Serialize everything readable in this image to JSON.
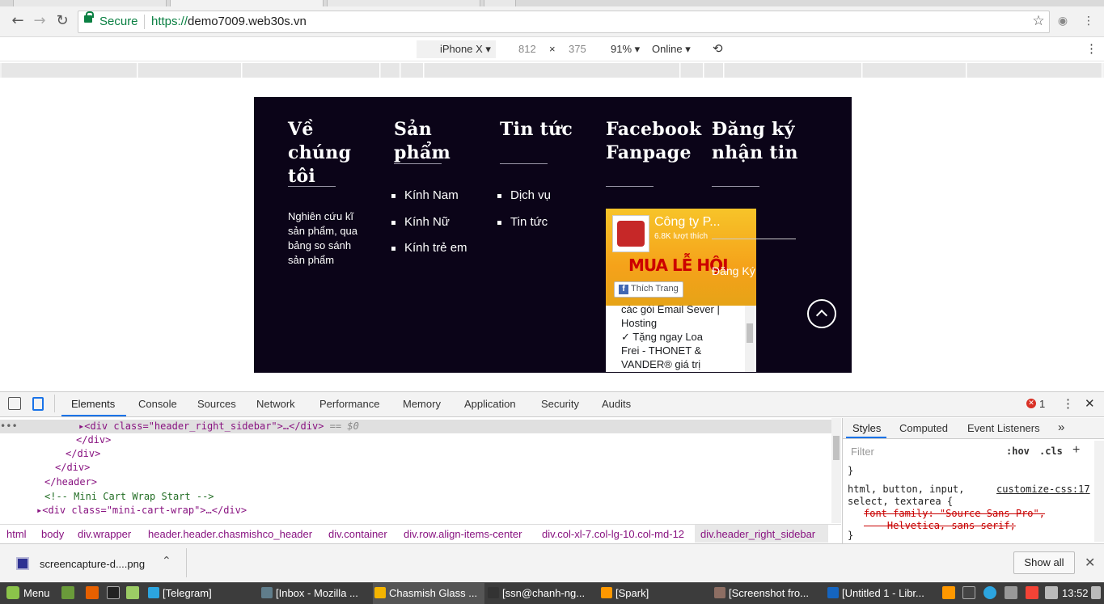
{
  "browser": {
    "secure_label": "Secure",
    "url_scheme": "https://",
    "url_host": "demo7009.web30s.vn"
  },
  "device_toolbar": {
    "device": "iPhone X",
    "width": "812",
    "times": "×",
    "height": "375",
    "zoom": "91%",
    "network": "Online"
  },
  "site": {
    "columns": [
      {
        "title": "Về chúng tôi",
        "text": "Nghiên cứu kĩ sản phẩm, qua bảng so sánh sản phẩm"
      },
      {
        "title": "Sản phẩm",
        "items": [
          "Kính Nam",
          "Kính Nữ",
          "Kính trẻ em"
        ]
      },
      {
        "title": "Tin tức",
        "items": [
          "Dịch vụ",
          "Tin tức"
        ]
      },
      {
        "title": "Facebook Fanpage"
      },
      {
        "title": "Đăng ký nhận tin",
        "subscribe": "Đăng Ký"
      }
    ],
    "facebook": {
      "page_name": "Công ty P...",
      "likes": "6.8K lượt thích",
      "banner_text": "MUA LỄ HỘI",
      "like_button": "Thích Trang",
      "post_text": "các gói Email Sever |\nHosting\n   ✓ Tặng ngay Loa\nFrei - THONET &\nVANDER® giá trị"
    }
  },
  "devtools": {
    "tabs": [
      "Elements",
      "Console",
      "Sources",
      "Network",
      "Performance",
      "Memory",
      "Application",
      "Security",
      "Audits"
    ],
    "error_count": "1",
    "elements_lines": [
      {
        "indent": 0,
        "text": "<div class=\"header_right_sidebar\">…</div>",
        "selected": true,
        "suffix": " == $0"
      },
      {
        "indent": 1,
        "text": "</div>"
      },
      {
        "indent": 2,
        "text": "</div>"
      },
      {
        "indent": 3,
        "text": "</div>"
      },
      {
        "indent": 4,
        "text": "</header>"
      },
      {
        "indent": 4,
        "text": "<!-- Mini Cart Wrap Start -->"
      },
      {
        "indent": 4,
        "text": "<div class=\"mini-cart-wrap\">…</div>"
      }
    ],
    "breadcrumbs": [
      "html",
      "body",
      "div.wrapper",
      "header.header.chasmishco_header",
      "div.container",
      "div.row.align-items-center",
      "div.col-xl-7.col-lg-10.col-md-12",
      "div.header_right_sidebar"
    ],
    "styles_tabs": [
      "Styles",
      "Computed",
      "Event Listeners"
    ],
    "filter_placeholder": "Filter",
    "hov": ":hov",
    "cls": ".cls",
    "rule_selector": "html, button, input,\nselect, textarea {",
    "rule_source": "customize-css:17",
    "rule_decl": "font-family: \"Source Sans Pro\",\n    Helvetica, sans-serif;"
  },
  "downloads": {
    "file": "screencapture-d....png",
    "show_all": "Show all"
  },
  "taskbar": {
    "menu": "Menu",
    "tasks": [
      "[Telegram]",
      "[Inbox - Mozilla ...",
      "Chasmish Glass ...",
      "[ssn@chanh-ng...",
      "[Spark]",
      "[Screenshot fro...",
      "[Untitled 1 - Libr..."
    ],
    "clock": "13:52"
  }
}
